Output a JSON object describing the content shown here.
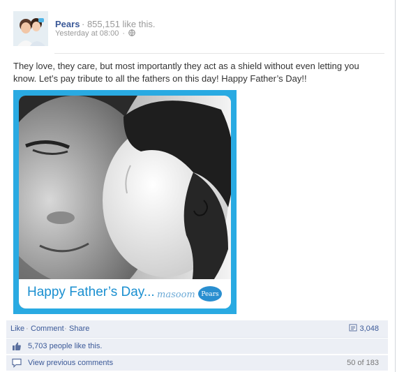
{
  "post": {
    "page_name": "Pears",
    "likes_text": "· 855,151 like this.",
    "timestamp": "Yesterday at 08:00",
    "timestamp_sep": "·",
    "body": "They love, they care, but most importantly they act as a shield without even letting you know. Let’s pay tribute to all the fathers on this day! Happy Father’s Day!!",
    "photo": {
      "caption": "Happy Father’s Day...",
      "logo_script": "masoom",
      "logo_brand": "Pears",
      "frame_color": "#29aae2"
    }
  },
  "actions": {
    "like": "Like",
    "comment": "Comment",
    "share": "Share",
    "separator": "·",
    "comments_count": "3,048"
  },
  "likes_row": {
    "text": "5,703 people like this."
  },
  "comments_row": {
    "view_previous": "View previous comments",
    "pager": "50 of 183"
  },
  "colors": {
    "link": "#3b5998",
    "meta": "#999999",
    "ufi_bg": "#eceff5"
  },
  "icons": [
    "globe-icon",
    "comment-count-icon",
    "thumbs-up-icon",
    "comment-bubble-icon"
  ]
}
